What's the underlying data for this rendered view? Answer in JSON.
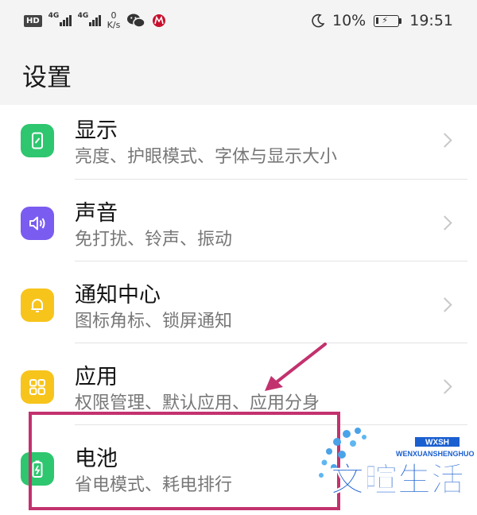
{
  "status_bar": {
    "hd": "HD",
    "net1": "4G",
    "net2": "4G",
    "speed_value": "0",
    "speed_unit": "K/s",
    "battery_percent": "10%",
    "time": "19:51"
  },
  "page": {
    "title": "设置"
  },
  "settings_items": [
    {
      "title": "显示",
      "subtitle": "亮度、护眼模式、字体与显示大小",
      "icon": "display-icon",
      "color": "#2ec66f"
    },
    {
      "title": "声音",
      "subtitle": "免打扰、铃声、振动",
      "icon": "speaker-icon",
      "color": "#7a5cf0"
    },
    {
      "title": "通知中心",
      "subtitle": "图标角标、锁屏通知",
      "icon": "bell-icon",
      "color": "#f7c41c"
    },
    {
      "title": "应用",
      "subtitle": "权限管理、默认应用、应用分身",
      "icon": "apps-grid-icon",
      "color": "#f7c41c"
    },
    {
      "title": "电池",
      "subtitle": "省电模式、耗电排行",
      "icon": "battery-icon",
      "color": "#2ec66f"
    }
  ],
  "annotation": {
    "color": "#c2326e"
  },
  "watermark": {
    "latin": "WENXUANSHENGHUO",
    "badge": "WXSH",
    "text": "文暄生活",
    "color": "#1a5fd0"
  }
}
